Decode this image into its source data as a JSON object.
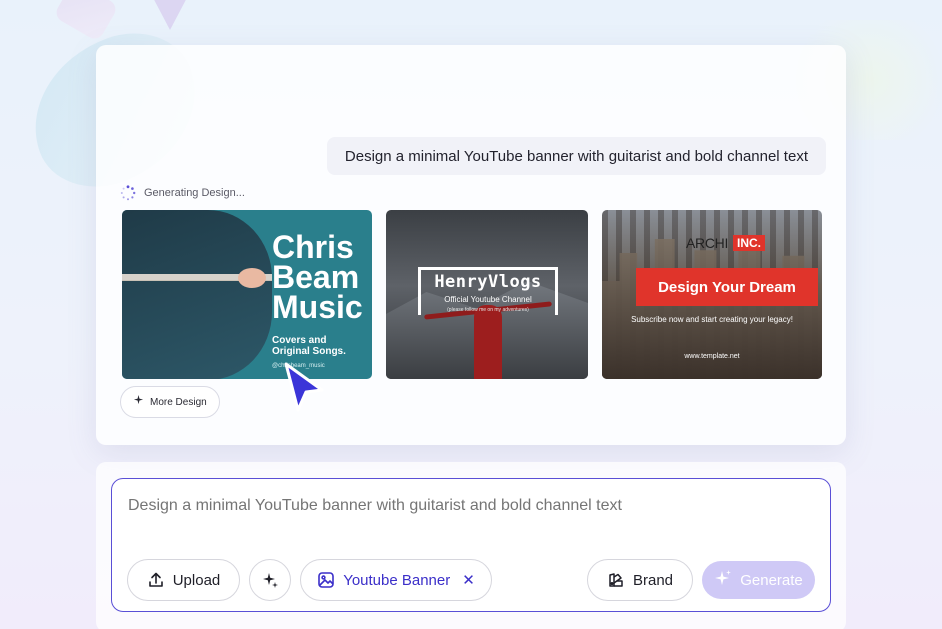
{
  "prompt_bubble": "Design a minimal YouTube banner with guitarist and bold channel text",
  "status": "Generating Design...",
  "designs": [
    {
      "title": "Chris Beam Music",
      "subtitle": "Covers and Original Songs.",
      "handle": "@chrisbeam_music"
    },
    {
      "brand": "HenryVlogs",
      "tagline": "Official Youtube Channel",
      "small": "(please follow me on my adventures)"
    },
    {
      "logo": "ARCHI",
      "logo_badge": "INC.",
      "headline": "Design Your Dream",
      "subline": "Subscribe now and start creating your legacy!",
      "url": "www.template.net"
    }
  ],
  "more_design": "More Design",
  "composer": {
    "placeholder": "Design a minimal YouTube banner with guitarist and bold channel text",
    "upload": "Upload",
    "chip": "Youtube Banner",
    "brand": "Brand",
    "generate": "Generate"
  },
  "colors": {
    "accent": "#5a4fd6",
    "chip_text": "#3b2fc9",
    "generate_disabled": "#cfc9f6",
    "red": "#e0342b"
  },
  "icons": [
    "spinner-icon",
    "sparkle-icon",
    "cursor-icon",
    "upload-icon",
    "magic-icon",
    "template-icon",
    "close-icon",
    "brand-icon",
    "sparkle-icon"
  ]
}
